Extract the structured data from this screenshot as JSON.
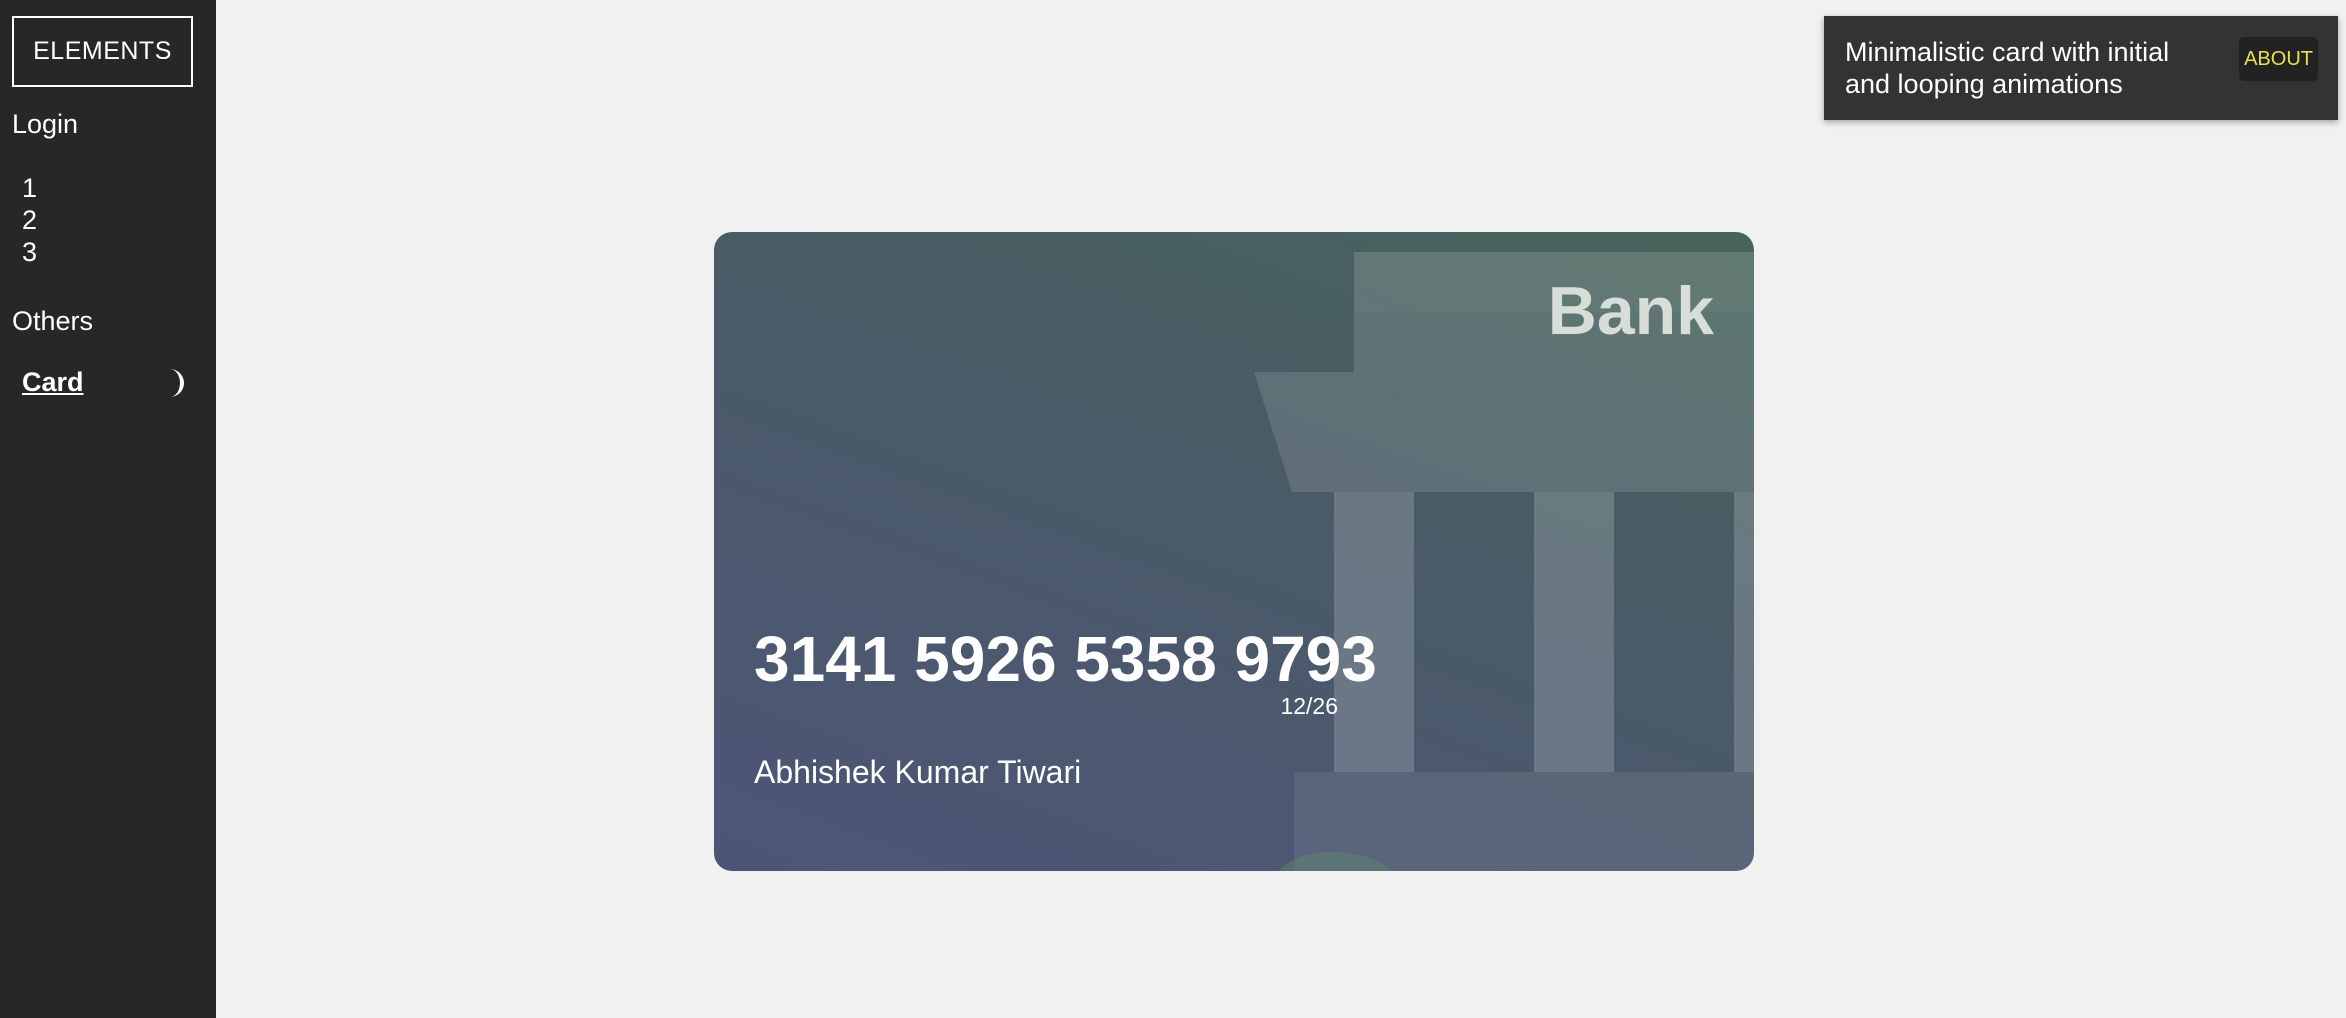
{
  "sidebar": {
    "brand": "ELEMENTS",
    "sections": [
      {
        "title": "Login",
        "items": [
          "1",
          "2",
          "3"
        ]
      },
      {
        "title": "Others",
        "items": [
          "Card"
        ]
      }
    ],
    "theme_icon": "moon-icon"
  },
  "about": {
    "description": "Minimalistic card with initial and looping animations",
    "button_label": "ABOUT",
    "button_color": "#e7e24c"
  },
  "card": {
    "bank_name": "Bank",
    "number": "3141 5926 5358 9793",
    "expiry": "12/26",
    "holder": "Abhishek Kumar Tiwari",
    "icon": "bank-building-icon"
  }
}
